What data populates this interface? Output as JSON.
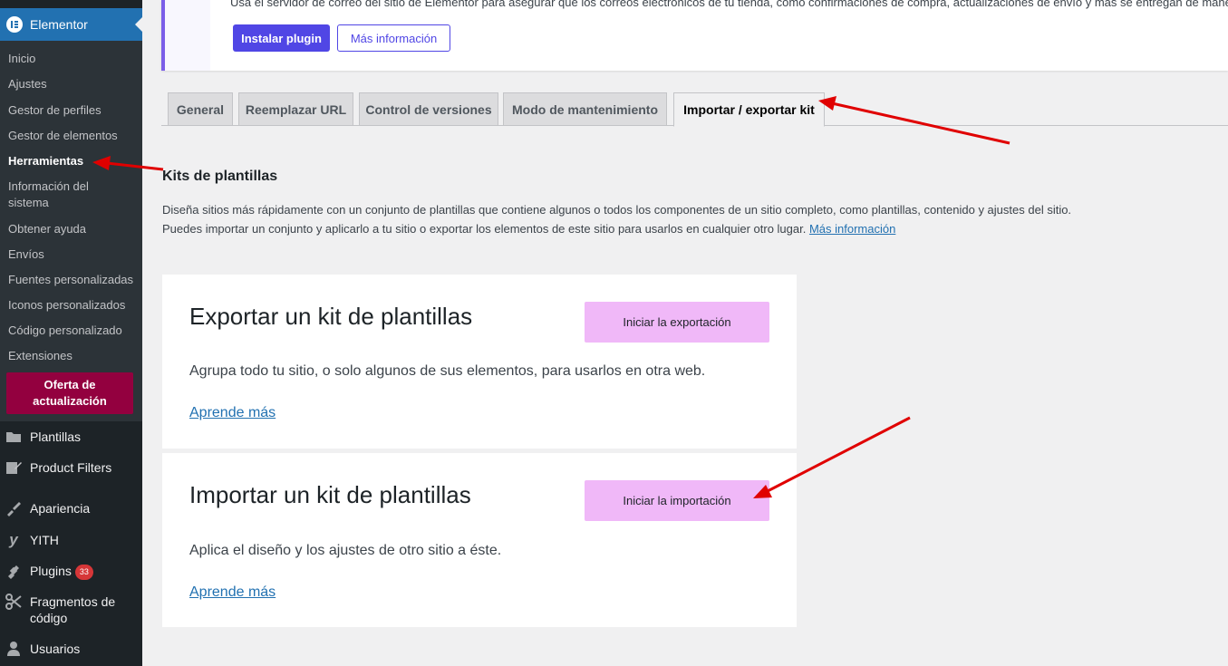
{
  "sidebar": {
    "active_label": "Elementor",
    "submenu": [
      {
        "label": "Inicio"
      },
      {
        "label": "Ajustes"
      },
      {
        "label": "Gestor de perfiles"
      },
      {
        "label": "Gestor de elementos"
      },
      {
        "label": "Herramientas"
      },
      {
        "label": "Información del sistema"
      },
      {
        "label": "Obtener ayuda"
      },
      {
        "label": "Envíos"
      },
      {
        "label": "Fuentes personalizadas"
      },
      {
        "label": "Iconos personalizados"
      },
      {
        "label": "Código personalizado"
      },
      {
        "label": "Extensiones"
      }
    ],
    "upgrade_label": "Oferta de actualización",
    "menu": [
      {
        "label": "Plantillas",
        "icon": "folder-icon"
      },
      {
        "label": "Product Filters",
        "icon": "edit-icon"
      },
      {
        "label": "Apariencia",
        "icon": "brush-icon"
      },
      {
        "label": "YITH",
        "icon": "yith-icon"
      },
      {
        "label": "Plugins",
        "icon": "plugin-icon",
        "badge": "33"
      },
      {
        "label": "Fragmentos de código",
        "icon": "scissors-icon"
      },
      {
        "label": "Usuarios",
        "icon": "user-icon"
      }
    ]
  },
  "notice": {
    "message": "Usa el servidor de correo del sitio de Elementor para asegurar que los correos electrónicos de tu tienda, como confirmaciones de compra, actualizaciones de envío y más se entregan de maner",
    "install_label": "Instalar plugin",
    "more_label": "Más información"
  },
  "tabs": [
    {
      "label": "General"
    },
    {
      "label": "Reemplazar URL"
    },
    {
      "label": "Control de versiones"
    },
    {
      "label": "Modo de mantenimiento"
    },
    {
      "label": "Importar / exportar kit"
    }
  ],
  "content": {
    "title": "Kits de plantillas",
    "desc_line1": "Diseña sitios más rápidamente con un conjunto de plantillas que contiene algunos o todos los componentes de un sitio completo, como plantillas, contenido y ajustes del sitio.",
    "desc_line2": "Puedes importar un conjunto y aplicarlo a tu sitio o exportar los elementos de este sitio para usarlos en cualquier otro lugar.",
    "desc_link": "Más información",
    "export": {
      "heading": "Exportar un kit de plantillas",
      "button": "Iniciar la exportación",
      "text": "Agrupa todo tu sitio, o solo algunos de sus elementos, para usarlos en otra web.",
      "link": "Aprende más"
    },
    "import": {
      "heading": "Importar un kit de plantillas",
      "button": "Iniciar la importación",
      "text": "Aplica el diseño y los ajustes de otro sitio a éste.",
      "link": "Aprende más"
    }
  },
  "colors": {
    "sidebar_bg": "#1d2327",
    "accent": "#2271b1",
    "kit_button": "#f0b8f8",
    "annotation_arrow": "#e00000"
  }
}
